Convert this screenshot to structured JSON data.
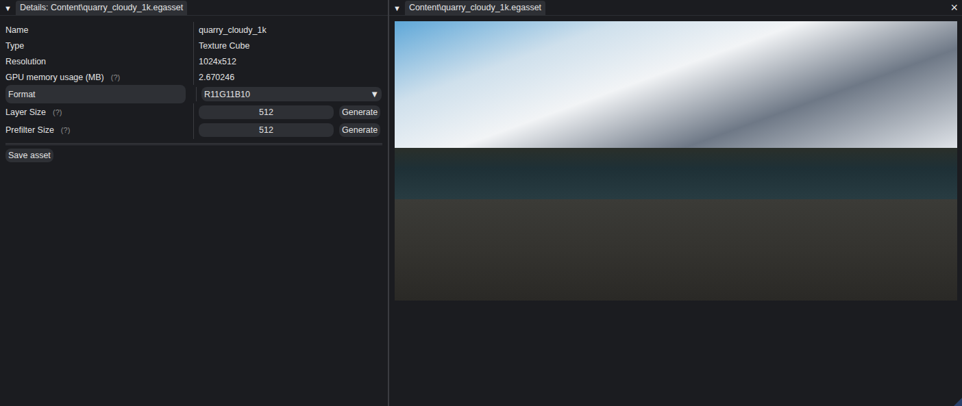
{
  "details_panel": {
    "collapse_glyph": "▼",
    "tab": {
      "label": "Details: Content\\quarry_cloudy_1k.egasset",
      "selected": true
    },
    "properties": [
      {
        "label": "Name",
        "help": "",
        "kind": "text",
        "value": "quarry_cloudy_1k",
        "button": ""
      },
      {
        "label": "Type",
        "help": "",
        "kind": "text",
        "value": "Texture Cube",
        "button": ""
      },
      {
        "label": "Resolution",
        "help": "",
        "kind": "text",
        "value": "1024x512",
        "button": ""
      },
      {
        "label": "GPU memory usage (MB)",
        "help": "(?)",
        "kind": "text",
        "value": "2.670246",
        "button": ""
      },
      {
        "label": "Format",
        "help": "",
        "kind": "dropdown",
        "value": "R11G11B10",
        "button": "▼"
      },
      {
        "label": "Layer Size",
        "help": "(?)",
        "kind": "size-input",
        "value": "512",
        "button": "Generate"
      },
      {
        "label": "Prefilter Size",
        "help": "(?)",
        "kind": "size-input",
        "value": "512",
        "button": "Generate"
      }
    ],
    "save_button": "Save asset"
  },
  "preview_panel": {
    "collapse_glyph": "▼",
    "tab": {
      "label": "Content\\quarry_cloudy_1k.egasset",
      "selected": true
    },
    "close_glyph": "×"
  }
}
